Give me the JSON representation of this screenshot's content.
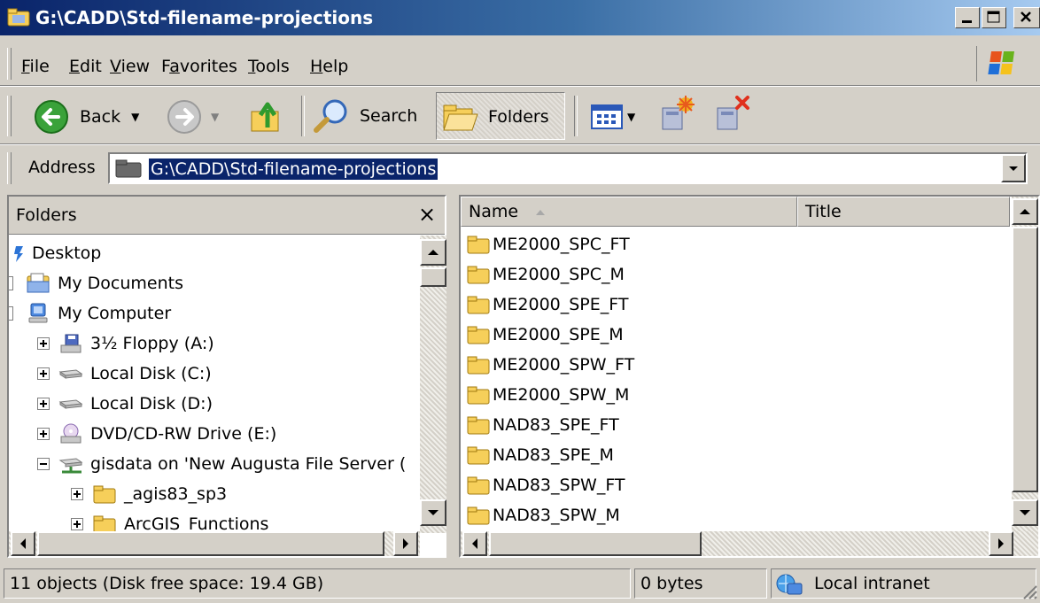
{
  "window": {
    "title": "G:\\CADD\\Std-filename-projections"
  },
  "menu": {
    "items": [
      {
        "label": "File",
        "mnemonic": "F"
      },
      {
        "label": "Edit",
        "mnemonic": "E"
      },
      {
        "label": "View",
        "mnemonic": "V"
      },
      {
        "label": "Favorites",
        "mnemonic": "a"
      },
      {
        "label": "Tools",
        "mnemonic": "T"
      },
      {
        "label": "Help",
        "mnemonic": "H"
      }
    ]
  },
  "toolbar": {
    "back_label": "Back",
    "search_label": "Search",
    "folders_label": "Folders"
  },
  "address": {
    "label": "Address",
    "value": "G:\\CADD\\Std-filename-projections"
  },
  "folders_pane": {
    "title": "Folders",
    "close_glyph": "×",
    "tree": [
      {
        "label": "Desktop",
        "icon": "desktop-icon"
      },
      {
        "label": "My Documents",
        "icon": "my-documents-icon"
      },
      {
        "label": "My Computer",
        "icon": "my-computer-icon"
      },
      {
        "label": "3½ Floppy (A:)",
        "icon": "floppy-icon"
      },
      {
        "label": "Local Disk (C:)",
        "icon": "hard-disk-icon"
      },
      {
        "label": "Local Disk (D:)",
        "icon": "hard-disk-icon"
      },
      {
        "label": "DVD/CD-RW Drive (E:)",
        "icon": "dvd-drive-icon"
      },
      {
        "label": "gisdata on 'New Augusta File Server (",
        "icon": "network-drive-icon"
      },
      {
        "label": "_agis83_sp3",
        "icon": "folder-icon"
      },
      {
        "label": "ArcGIS_Functions",
        "icon": "folder-icon"
      }
    ]
  },
  "files_pane": {
    "columns": [
      {
        "label": "Name",
        "sorted": "ascending"
      },
      {
        "label": "Title"
      }
    ],
    "files": [
      "ME2000_SPC_FT",
      "ME2000_SPC_M",
      "ME2000_SPE_FT",
      "ME2000_SPE_M",
      "ME2000_SPW_FT",
      "ME2000_SPW_M",
      "NAD83_SPE_FT",
      "NAD83_SPE_M",
      "NAD83_SPW_FT",
      "NAD83_SPW_M"
    ]
  },
  "status": {
    "objects": "11 objects (Disk free space: 19.4 GB)",
    "size": "0 bytes",
    "zone": "Local intranet"
  },
  "colors": {
    "titlebar_start": "#0a246a",
    "titlebar_end": "#a6caf0",
    "face": "#d4d0c8",
    "selection": "#0a246a",
    "folder": "#f6cf5a"
  }
}
